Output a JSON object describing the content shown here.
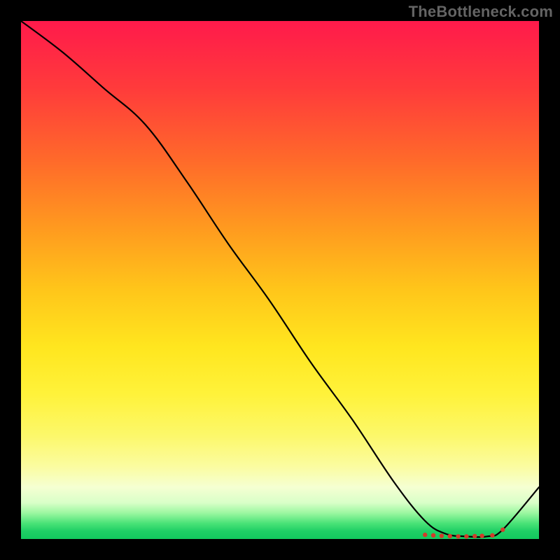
{
  "watermark": "TheBottleneck.com",
  "chart_data": {
    "type": "line",
    "title": "",
    "xlabel": "",
    "ylabel": "",
    "xlim": [
      0,
      100
    ],
    "ylim": [
      0,
      100
    ],
    "grid": false,
    "legend": false,
    "series": [
      {
        "name": "curve",
        "x": [
          0,
          8,
          16,
          24,
          32,
          40,
          48,
          56,
          64,
          72,
          78,
          82,
          86,
          90,
          93,
          100
        ],
        "values": [
          100,
          94,
          87,
          80,
          69,
          57,
          46,
          34,
          23,
          11,
          3.5,
          1,
          0.5,
          0.5,
          1.8,
          10
        ]
      }
    ],
    "flat_zone": {
      "x_start": 78,
      "x_end": 92,
      "value": 0.7
    },
    "markers": {
      "color": "#d23b2a",
      "points": [
        {
          "x": 78.0,
          "y": 0.8
        },
        {
          "x": 79.6,
          "y": 0.7
        },
        {
          "x": 81.2,
          "y": 0.6
        },
        {
          "x": 82.8,
          "y": 0.55
        },
        {
          "x": 84.4,
          "y": 0.5
        },
        {
          "x": 86.0,
          "y": 0.5
        },
        {
          "x": 87.6,
          "y": 0.55
        },
        {
          "x": 89.0,
          "y": 0.6
        },
        {
          "x": 91.0,
          "y": 0.7
        },
        {
          "x": 93.0,
          "y": 1.8
        }
      ]
    }
  }
}
